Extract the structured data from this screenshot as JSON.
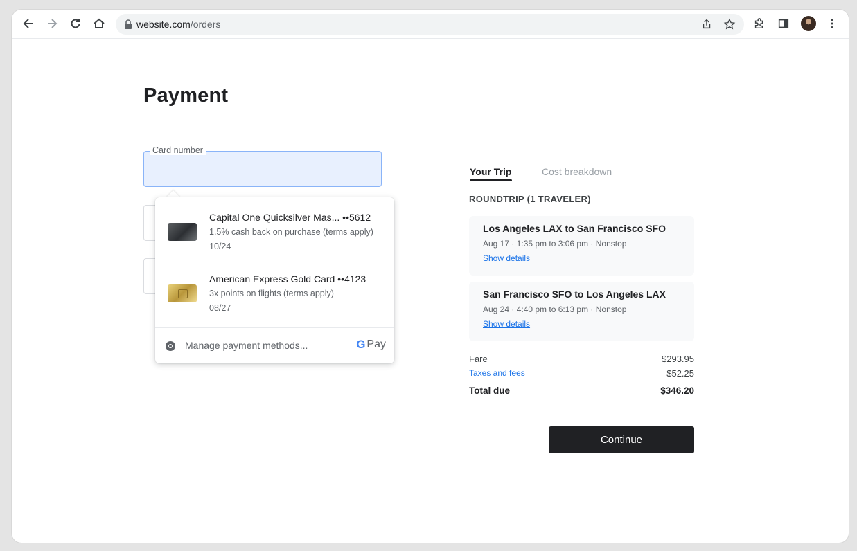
{
  "browser": {
    "url_host": "website.com",
    "url_path": "/orders"
  },
  "page": {
    "title": "Payment",
    "card_field_label": "Card number"
  },
  "autofill": {
    "suggestions": [
      {
        "title": "Capital One Quicksilver Mas... ••5612",
        "subtitle": "1.5% cash back on purchase (terms apply)",
        "expiry": "10/24",
        "thumb": "capital-one-card"
      },
      {
        "title": "American Express Gold Card ••4123",
        "subtitle": "3x points on flights (terms apply)",
        "expiry": "08/27",
        "thumb": "amex-gold-card"
      }
    ],
    "manage_label": "Manage payment methods...",
    "gpay_label": "Pay"
  },
  "trip": {
    "tabs": [
      "Your Trip",
      "Cost breakdown"
    ],
    "section_heading": "ROUNDTRIP (1 TRAVELER)",
    "flights": [
      {
        "route": "Los Angeles LAX to San Francisco SFO",
        "time": "Aug 17 · 1:35 pm to 3:06 pm · Nonstop",
        "link": "Show details"
      },
      {
        "route": "San Francisco SFO to Los Angeles LAX",
        "time": "Aug 24 · 4:40 pm to 6:13 pm · Nonstop",
        "link": "Show details"
      }
    ],
    "costs": {
      "fare_label": "Fare",
      "fare_value": "$293.95",
      "taxes_label": "Taxes and fees",
      "taxes_value": "$52.25",
      "total_label": "Total due",
      "total_value": "$346.20"
    },
    "continue_label": "Continue"
  },
  "colors": {
    "accent_blue": "#1a73e8",
    "button_dark": "#202124",
    "field_fill": "#e8f0fe"
  }
}
